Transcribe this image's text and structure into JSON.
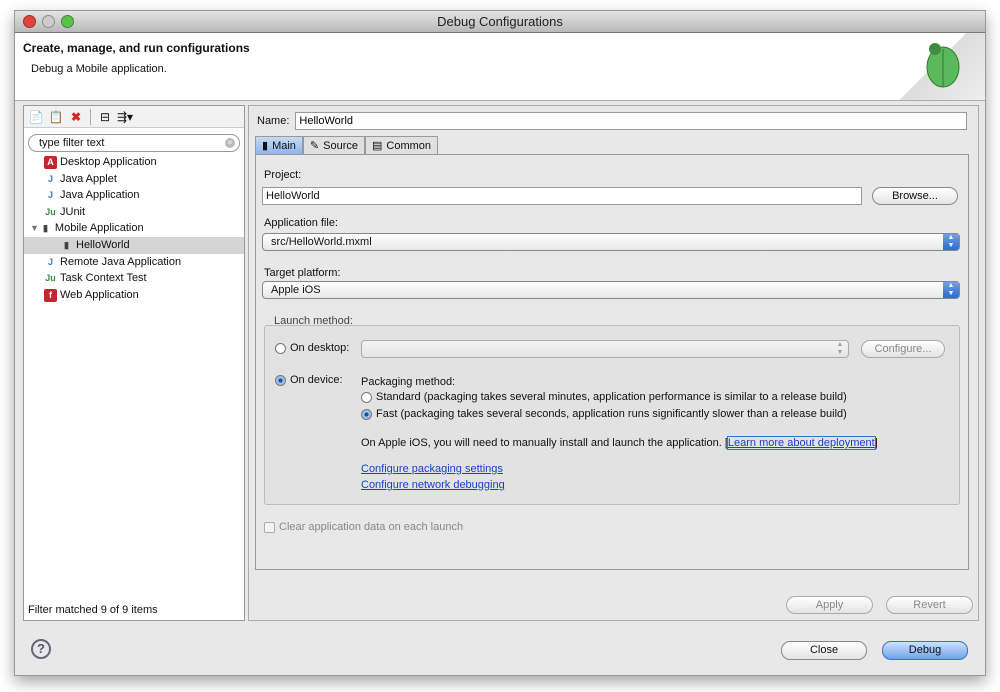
{
  "window": {
    "title": "Debug Configurations"
  },
  "banner": {
    "title": "Create, manage, and run configurations",
    "subtitle": "Debug a Mobile application."
  },
  "sidebar": {
    "toolbar": [
      "new-config-icon",
      "duplicate-icon",
      "delete-icon",
      "collapse-all-icon",
      "filter-icon"
    ],
    "filter_placeholder": "type filter text",
    "items": [
      {
        "label": "Desktop Application",
        "icon": "desktop-app-icon",
        "color": "#c0282d",
        "glyph": "A"
      },
      {
        "label": "Java Applet",
        "icon": "java-applet-icon",
        "color": "#4a78c0",
        "glyph": "J"
      },
      {
        "label": "Java Application",
        "icon": "java-app-icon",
        "color": "#4a78c0",
        "glyph": "J"
      },
      {
        "label": "JUnit",
        "icon": "junit-icon",
        "color": "#3b8a3b",
        "glyph": "Ju"
      },
      {
        "label": "Mobile Application",
        "icon": "mobile-app-icon",
        "color": "#444",
        "glyph": "▮"
      },
      {
        "label": "HelloWorld",
        "icon": "mobile-config-icon",
        "color": "#444",
        "glyph": "▮"
      },
      {
        "label": "Remote Java Application",
        "icon": "remote-java-icon",
        "color": "#4a78c0",
        "glyph": "J"
      },
      {
        "label": "Task Context Test",
        "icon": "task-context-icon",
        "color": "#3b8a3b",
        "glyph": "Ju"
      },
      {
        "label": "Web Application",
        "icon": "web-app-icon",
        "color": "#c0282d",
        "glyph": "f"
      }
    ],
    "status": "Filter matched 9 of 9 items"
  },
  "main": {
    "name_label": "Name:",
    "name_value": "HelloWorld",
    "tabs": [
      {
        "label": "Main"
      },
      {
        "label": "Source"
      },
      {
        "label": "Common"
      }
    ],
    "project_label": "Project:",
    "project_value": "HelloWorld",
    "browse": "Browse...",
    "appfile_label": "Application file:",
    "appfile_value": "src/HelloWorld.mxml",
    "platform_label": "Target platform:",
    "platform_value": "Apple iOS",
    "launch_label": "Launch method:",
    "on_desktop": "On desktop:",
    "configure": "Configure...",
    "on_device": "On device:",
    "packaging_label": "Packaging method:",
    "standard": "Standard (packaging takes several minutes, application performance is similar to a release build)",
    "fast": "Fast (packaging takes several seconds, application runs significantly slower than a release build)",
    "ios_note": "On Apple iOS, you will need to manually install and launch the application.",
    "learn_more": "Learn more about deployment",
    "config_pack": "Configure packaging settings",
    "config_net": "Configure network debugging",
    "clear_data": "Clear application data on each launch",
    "apply": "Apply",
    "revert": "Revert"
  },
  "footer": {
    "close": "Close",
    "debug": "Debug"
  }
}
